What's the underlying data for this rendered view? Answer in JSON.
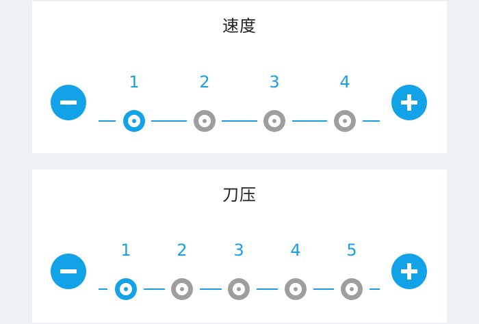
{
  "speed": {
    "title": "速度",
    "decrease_icon": "minus-icon",
    "increase_icon": "plus-icon",
    "selected_step": 1,
    "steps": [
      "1",
      "2",
      "3",
      "4"
    ]
  },
  "pressure": {
    "title": "刀压",
    "decrease_icon": "minus-icon",
    "increase_icon": "plus-icon",
    "selected_step": 1,
    "steps": [
      "1",
      "2",
      "3",
      "4",
      "5"
    ]
  },
  "colors": {
    "accent": "#11a2e8",
    "inactive_step": "#9e9e9e",
    "card_background": "#ffffff",
    "page_background": "#edf1f6"
  }
}
